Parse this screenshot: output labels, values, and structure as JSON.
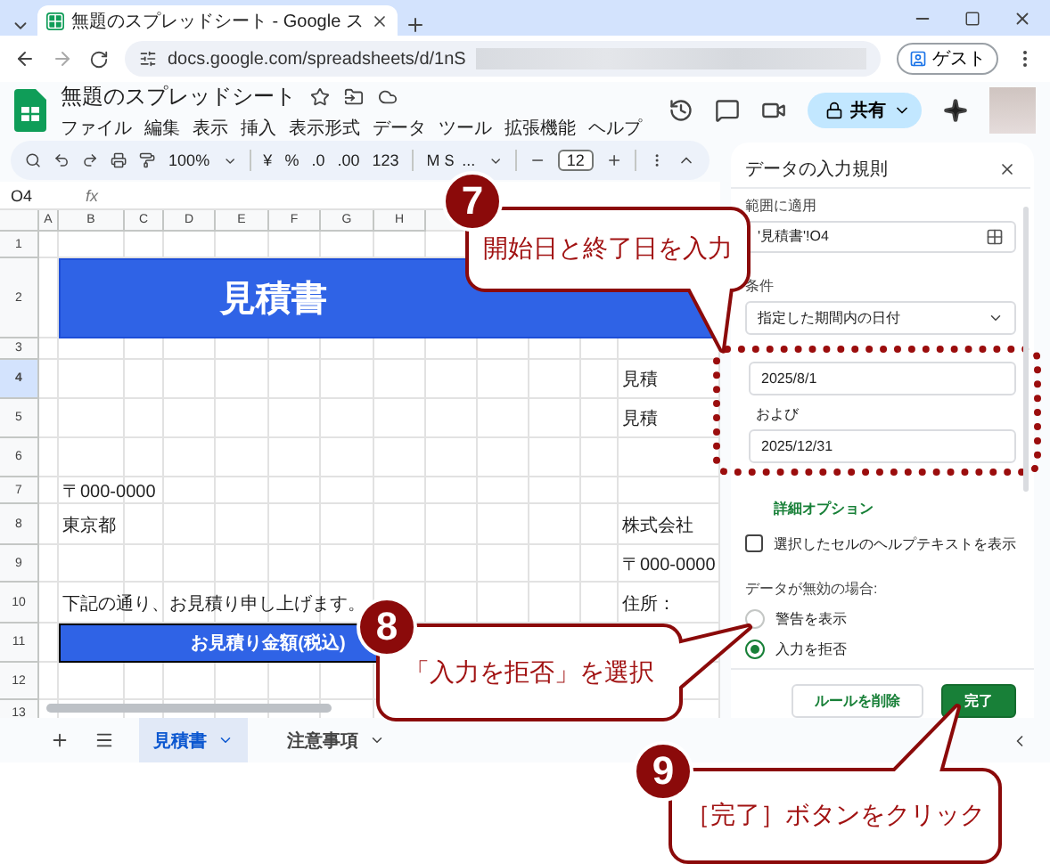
{
  "browser": {
    "tab_title": "無題のスプレッドシート - Google ス",
    "url": "docs.google.com/spreadsheets/d/1nS",
    "profile": "ゲスト"
  },
  "document": {
    "title": "無題のスプレッドシート",
    "menu": [
      "ファイル",
      "編集",
      "表示",
      "挿入",
      "表示形式",
      "データ",
      "ツール",
      "拡張機能",
      "ヘルプ"
    ],
    "share": "共有"
  },
  "toolbar": {
    "zoom": "100%",
    "currency": "¥",
    "percent": "%",
    "decrease_decimal": ".0",
    "increase_decimal": ".00",
    "number_format": "123",
    "font": "ＭＳ ...",
    "font_size": "12"
  },
  "formula_bar": {
    "cell_ref": "O4",
    "fx": "fx"
  },
  "sheet": {
    "columns": [
      "A",
      "B",
      "C",
      "D",
      "E",
      "F",
      "G",
      "H"
    ],
    "rows": [
      {
        "label": "1",
        "selected": false
      },
      {
        "label": "2",
        "selected": false,
        "kind": "banner",
        "B": "見積書"
      },
      {
        "label": "3",
        "selected": false
      },
      {
        "label": "4",
        "selected": true,
        "O": "見積"
      },
      {
        "label": "5",
        "selected": false,
        "O": "見積"
      },
      {
        "label": "6",
        "selected": false
      },
      {
        "label": "7",
        "selected": false,
        "kind": "plain",
        "B": "〒000-0000"
      },
      {
        "label": "8",
        "selected": false,
        "kind": "plain",
        "B": "東京都",
        "O": "株式会社"
      },
      {
        "label": "9",
        "selected": false,
        "O": "〒000-0000"
      },
      {
        "label": "10",
        "selected": false,
        "kind": "plain",
        "B": "下記の通り、お見積り申し上げます。",
        "O": "住所："
      },
      {
        "label": "11",
        "selected": false,
        "kind": "band",
        "B": "お見積り金額(税込)"
      },
      {
        "label": "12",
        "selected": false
      },
      {
        "label": "13",
        "selected": false
      }
    ]
  },
  "sheet_tabs": [
    {
      "label": "見積書",
      "selected": true
    },
    {
      "label": "注意事項",
      "selected": false
    }
  ],
  "panel": {
    "title": "データの入力規則",
    "range_label": "範囲に適用",
    "range": "'見積書'!O4",
    "criteria_label": "条件",
    "criteria": "指定した期間内の日付",
    "start_date": "2025/8/1",
    "conjunction": "および",
    "end_date": "2025/12/31",
    "advanced_link": "詳細オプション",
    "help_text": {
      "label": "選択したセルのヘルプテキストを表示",
      "checked": false
    },
    "invalid_label": "データが無効の場合:",
    "invalid_options": [
      {
        "label": "警告を表示",
        "selected": false
      },
      {
        "label": "入力を拒否",
        "selected": true
      }
    ],
    "remove_button": "ルールを削除",
    "done_button": "完了"
  },
  "annotations": [
    {
      "number": "7",
      "text": "開始日と終了日を入力"
    },
    {
      "number": "8",
      "text": "「入力を拒否」を選択"
    },
    {
      "number": "9",
      "text": "［完了］ボタンをクリック"
    }
  ]
}
